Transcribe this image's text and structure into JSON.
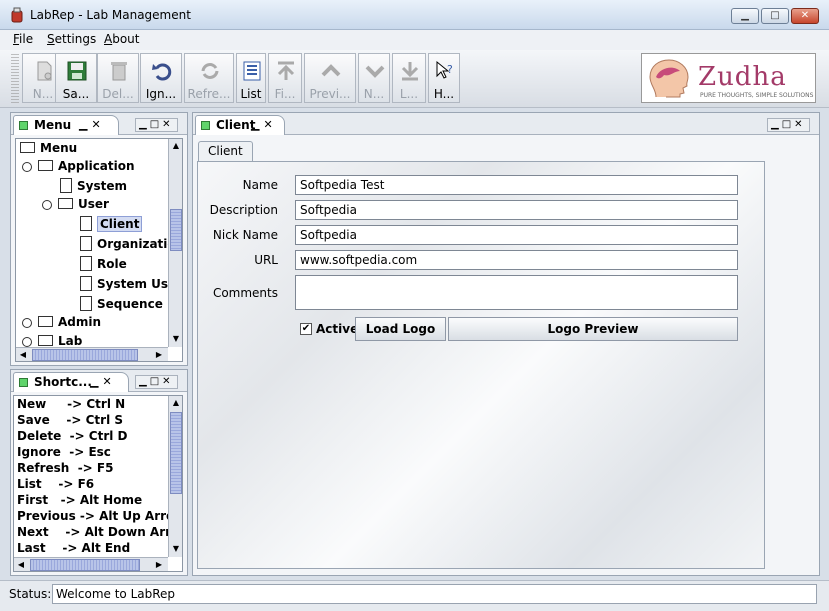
{
  "window": {
    "title": "LabRep - Lab Management",
    "controls": [
      "minimize",
      "maximize",
      "close"
    ]
  },
  "menubar": {
    "items": [
      {
        "label": "File",
        "mnemonic": "F"
      },
      {
        "label": "Settings",
        "mnemonic": "S"
      },
      {
        "label": "About",
        "mnemonic": "A"
      }
    ]
  },
  "toolbar": {
    "buttons": [
      {
        "label": "N...",
        "icon": "new-doc-icon",
        "enabled": false
      },
      {
        "label": "Sa...",
        "icon": "save-icon",
        "enabled": true
      },
      {
        "label": "Del...",
        "icon": "trash-icon",
        "enabled": false
      },
      {
        "label": "Ign...",
        "icon": "undo-icon",
        "enabled": true
      },
      {
        "label": "Refre...",
        "icon": "refresh-icon",
        "enabled": false
      },
      {
        "label": "List",
        "icon": "list-icon",
        "enabled": true
      },
      {
        "label": "Fi...",
        "icon": "first-icon",
        "enabled": false
      },
      {
        "label": "Previ...",
        "icon": "previous-icon",
        "enabled": false
      },
      {
        "label": "N...",
        "icon": "next-icon",
        "enabled": false
      },
      {
        "label": "L...",
        "icon": "last-icon",
        "enabled": false
      },
      {
        "label": "H...",
        "icon": "help-icon",
        "enabled": true
      }
    ],
    "logo": {
      "name": "Zudha",
      "tagline": "PURE THOUGHTS, SIMPLE SOLUTIONS"
    }
  },
  "menu_panel": {
    "tab_label": "Menu",
    "tree": [
      {
        "label": "Menu",
        "type": "folder",
        "level": 0
      },
      {
        "label": "Application",
        "type": "folder",
        "level": 1,
        "expanded": true
      },
      {
        "label": "System",
        "type": "doc",
        "level": 2
      },
      {
        "label": "User",
        "type": "folder",
        "level": 2,
        "expanded": true
      },
      {
        "label": "Client",
        "type": "doc",
        "level": 3,
        "selected": true
      },
      {
        "label": "Organization",
        "type": "doc",
        "level": 3
      },
      {
        "label": "Role",
        "type": "doc",
        "level": 3
      },
      {
        "label": "System User",
        "type": "doc",
        "level": 3
      },
      {
        "label": "Sequence",
        "type": "doc",
        "level": 3
      },
      {
        "label": "Admin",
        "type": "folder",
        "level": 1,
        "expanded": false
      },
      {
        "label": "Lab",
        "type": "folder",
        "level": 1,
        "expanded": false
      }
    ]
  },
  "shortcuts_panel": {
    "tab_label": "Shortc...",
    "lines": [
      "New     -> Ctrl N",
      "Save    -> Ctrl S",
      "Delete  -> Ctrl D",
      "Ignore  -> Esc",
      "Refresh  -> F5",
      "List    -> F6",
      "First   -> Alt Home",
      "Previous -> Alt Up Arrow",
      "Next    -> Alt Down Arrow",
      "Last    -> Alt End"
    ]
  },
  "main_panel": {
    "tab_label": "Client",
    "inner_tab": "Client",
    "form": {
      "name_label": "Name",
      "name_value": "Softpedia Test",
      "description_label": "Description",
      "description_value": "Softpedia",
      "nickname_label": "Nick Name",
      "nickname_value": "Softpedia",
      "url_label": "URL",
      "url_value": "www.softpedia.com",
      "comments_label": "Comments",
      "comments_value": "",
      "active_label": "Active",
      "active_checked": true,
      "load_logo_label": "Load Logo",
      "logo_preview_label": "Logo Preview"
    }
  },
  "statusbar": {
    "label": "Status:",
    "message": "Welcome to LabRep"
  },
  "colors": {
    "selection": "#d4dcf2",
    "active_square": "#5fd46b",
    "scroll_thumb": "#aab6e4",
    "logo": "#a33a68"
  }
}
